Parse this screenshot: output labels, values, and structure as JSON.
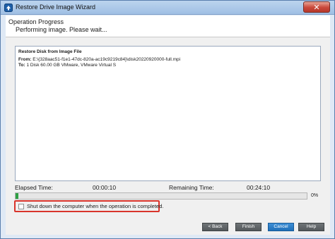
{
  "window": {
    "title": "Restore Drive Image Wizard",
    "close_glyph": "✕"
  },
  "header": {
    "heading": "Operation Progress",
    "subheading": "Performing image. Please wait..."
  },
  "details": {
    "title": "Restore Disk from Image File",
    "from_label": "From:",
    "from_value": "E:\\{328aac51-f1e1-47dc-820a-ac19c9219c84}\\disk20220920000-full.mpi",
    "to_label": "To:",
    "to_value": "1 Disk 60.00 GB VMware, VMware Virtual S"
  },
  "progress": {
    "elapsed_label": "Elapsed Time:",
    "elapsed_value": "00:00:10",
    "remaining_label": "Remaining Time:",
    "remaining_value": "00:24:10",
    "percent_text": "0%",
    "fraction": 0.01
  },
  "shutdown_option": {
    "label": "Shut down the computer when the operation is completed.",
    "checked": false
  },
  "buttons": {
    "back": "< Back",
    "finish": "Finish",
    "cancel": "Cancel",
    "help": "Help"
  },
  "colors": {
    "progress_green": "#2ea043",
    "highlight_red": "#d9342b",
    "primary_blue": "#1f6fb8"
  },
  "icons": {
    "app": "restore-wizard-icon",
    "close": "close-icon"
  }
}
